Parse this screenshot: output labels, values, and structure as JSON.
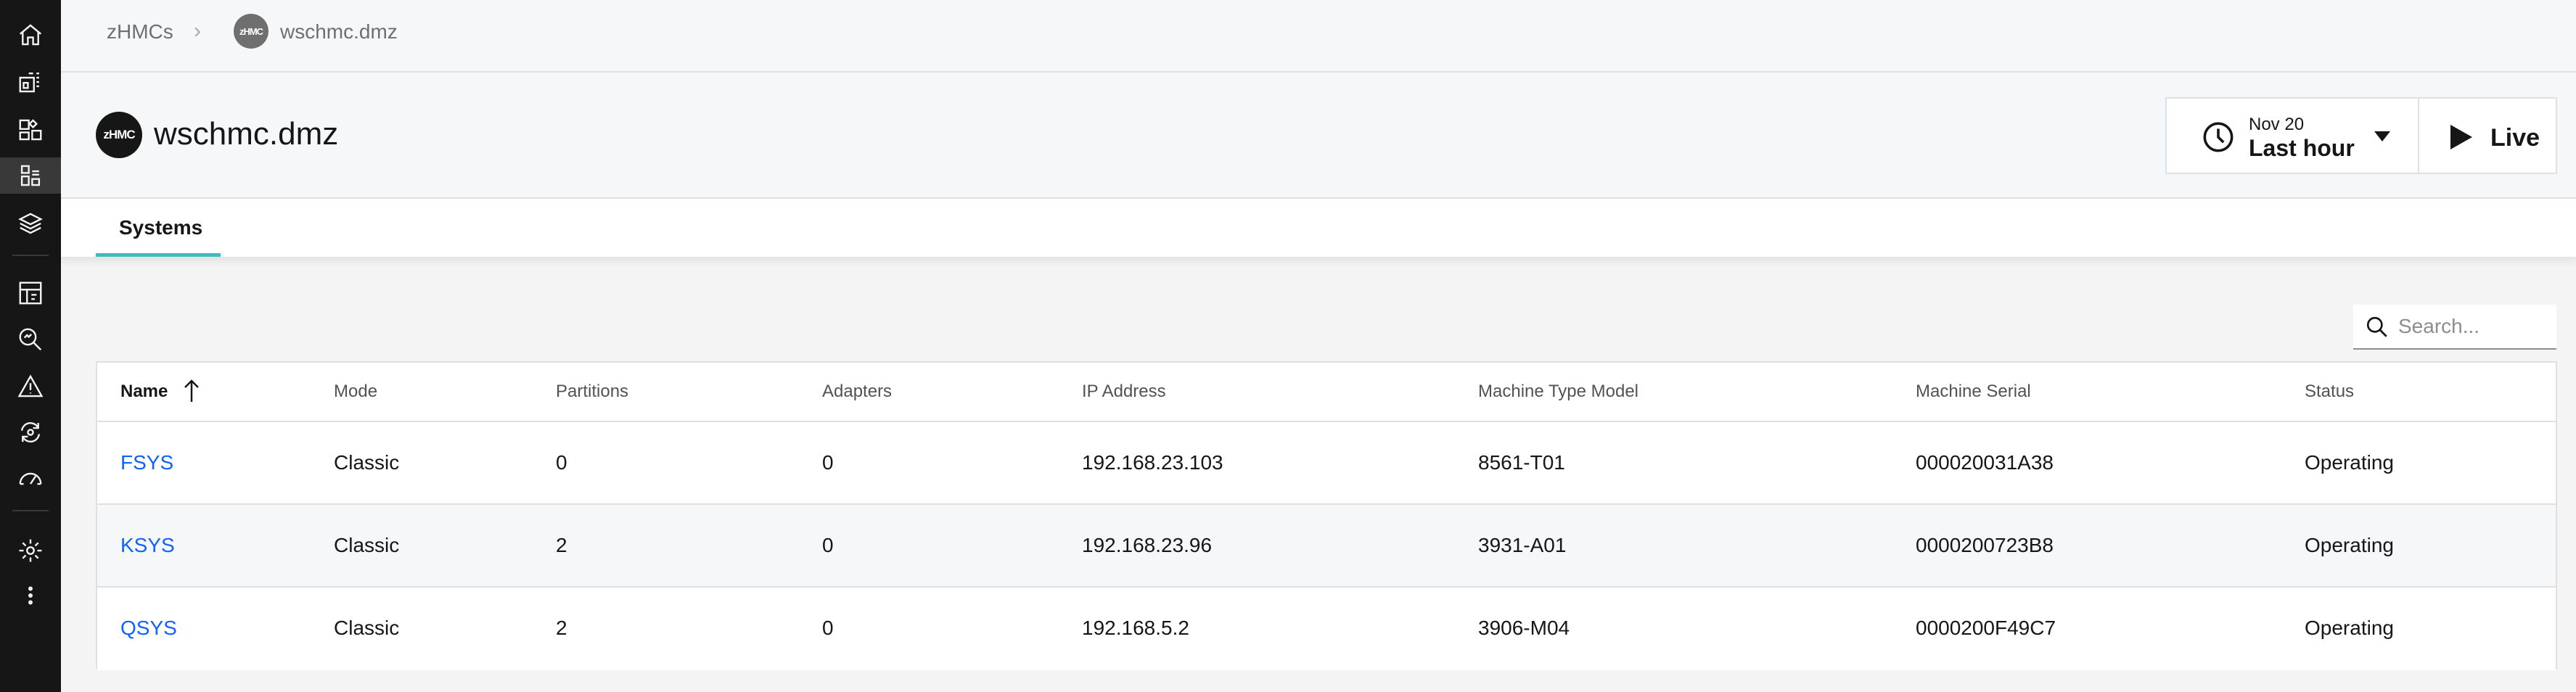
{
  "breadcrumb": {
    "root": "zHMCs",
    "avatar_text": "zHMC",
    "current": "wschmc.dmz"
  },
  "header": {
    "avatar_text": "zHMC",
    "title": "wschmc.dmz"
  },
  "time_picker": {
    "date": "Nov 20",
    "range": "Last hour"
  },
  "live_button": {
    "label": "Live"
  },
  "tabs": [
    {
      "label": "Systems",
      "active": true
    }
  ],
  "search": {
    "placeholder": "Search...",
    "value": ""
  },
  "table": {
    "sorted_column": "Name",
    "sort_direction": "ascending",
    "columns": [
      "Name",
      "Mode",
      "Partitions",
      "Adapters",
      "IP Address",
      "Machine Type Model",
      "Machine Serial",
      "Status"
    ],
    "rows": [
      [
        "FSYS",
        "Classic",
        "0",
        "0",
        "192.168.23.103",
        "8561-T01",
        "000020031A38",
        "Operating"
      ],
      [
        "KSYS",
        "Classic",
        "2",
        "0",
        "192.168.23.96",
        "3931-A01",
        "0000200723B8",
        "Operating"
      ],
      [
        "QSYS",
        "Classic",
        "2",
        "0",
        "192.168.5.2",
        "3906-M04",
        "0000200F49C7",
        "Operating"
      ]
    ]
  },
  "nav": {
    "icons": [
      "home-icon",
      "dashboard-icon",
      "apps-icon",
      "systems-icon",
      "layers-icon",
      "report-icon",
      "analyze-icon",
      "warning-icon",
      "automation-icon",
      "performance-icon",
      "settings-icon",
      "overflow-menu-icon"
    ]
  },
  "colors": {
    "link": "#0f62fe",
    "tab_accent": "#3ebcc1",
    "rail_background": "#161616"
  }
}
